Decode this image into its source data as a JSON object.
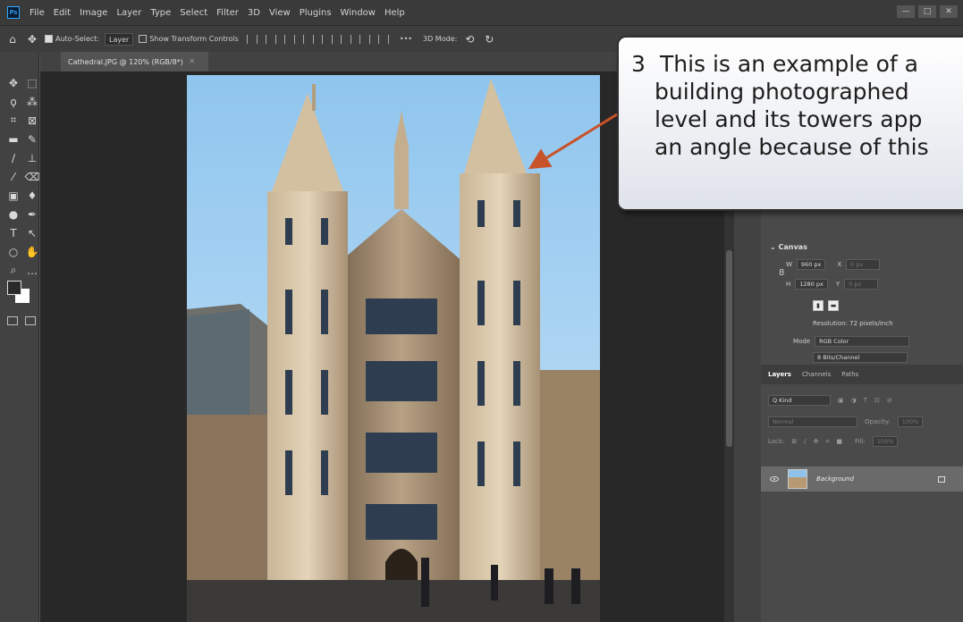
{
  "menubar": {
    "logo": "Ps",
    "items": [
      "File",
      "Edit",
      "Image",
      "Layer",
      "Type",
      "Select",
      "Filter",
      "3D",
      "View",
      "Plugins",
      "Window",
      "Help"
    ],
    "window_controls": [
      "—",
      "□",
      "✕"
    ]
  },
  "options_bar": {
    "auto_select_label": "Auto-Select:",
    "auto_select_value": "Layer",
    "show_transform_label": "Show Transform Controls",
    "more": "•••",
    "mode_3d_label": "3D Mode:"
  },
  "document_tab": {
    "title": "Cathedral.JPG @ 120% (RGB/8*)",
    "close": "×"
  },
  "properties": {
    "section": "Canvas",
    "w_label": "W",
    "w_value": "960 px",
    "x_label": "X",
    "x_value": "0 px",
    "h_label": "H",
    "h_value": "1280 px",
    "y_label": "Y",
    "y_value": "0 px",
    "resolution": "Resolution: 72 pixels/inch",
    "mode_label": "Mode",
    "mode_value": "RGB Color",
    "bits_value": "8 Bits/Channel"
  },
  "layers_panel": {
    "tabs": [
      "Layers",
      "Channels",
      "Paths"
    ],
    "kind": "Q Kind",
    "blend_mode": "Normal",
    "opacity_label": "Opacity:",
    "opacity_value": "100%",
    "lock_label": "Lock:",
    "fill_label": "Fill:",
    "fill_value": "100%",
    "layer_name": "Background"
  },
  "callout": {
    "number": "3",
    "lines": [
      "This is an example of a",
      "building photographed",
      "level and its towers app",
      "an angle because of this"
    ]
  },
  "colors": {
    "callout_arrow": "#c8532a",
    "sky": "#9fcdef"
  }
}
